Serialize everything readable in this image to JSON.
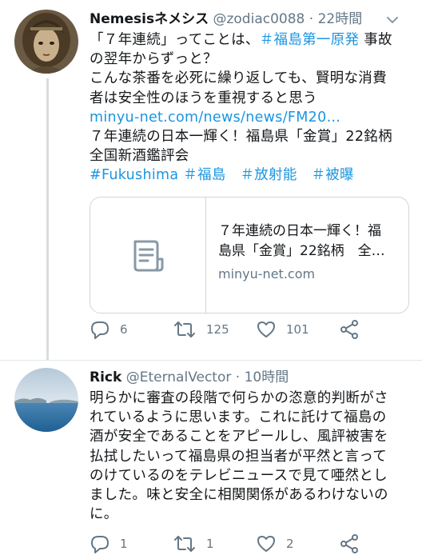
{
  "tweets": [
    {
      "display_name": "Nemesisネメシス",
      "handle": "@zodiac0088",
      "separator": "·",
      "time": "22時間",
      "lines": [
        [
          {
            "t": "「７年連続」ってことは、"
          },
          {
            "t": "＃福島第一原発",
            "link": true
          },
          {
            "t": " 事故"
          }
        ],
        [
          {
            "t": "の翌年からずっと？"
          }
        ],
        [
          {
            "t": "こんな茶番を必死に繰り返しても、賢明な消費"
          }
        ],
        [
          {
            "t": "者は安全性のほうを重視すると思う"
          }
        ],
        [
          {
            "t": "minyu-net.com/news/news/FM20…",
            "link": true
          }
        ],
        [
          {
            "t": "７年連続の日本一輝く！福島県「金賞」22銘柄"
          }
        ],
        [
          {
            "t": "全国新酒鑑評会"
          }
        ],
        [
          {
            "t": "#Fukushima ＃福島　＃放射能　＃被曝",
            "link": true
          }
        ]
      ],
      "card": {
        "title_lines": [
          "７年連続の日本一輝く！福",
          "島県「金賞」22銘柄　全…"
        ],
        "domain": "minyu-net.com"
      },
      "replies": "6",
      "retweets": "125",
      "likes": "101"
    },
    {
      "display_name": "Rick",
      "handle": "@EternalVector",
      "separator": "·",
      "time": "10時間",
      "lines": [
        [
          {
            "t": "明らかに審査の段階で何らかの恣意的判断がさ"
          }
        ],
        [
          {
            "t": "れているように思います。これに託けて福島の"
          }
        ],
        [
          {
            "t": "酒が安全であることをアピールし、風評被害を"
          }
        ],
        [
          {
            "t": "払拭したいって福島県の担当者が平然と言って"
          }
        ],
        [
          {
            "t": "のけているのをテレビニュースで見て唖然とし"
          }
        ],
        [
          {
            "t": "ました。味と安全に相関関係があるわけないの"
          }
        ],
        [
          {
            "t": "に。"
          }
        ]
      ],
      "replies": "1",
      "retweets": "1",
      "likes": "2"
    }
  ]
}
